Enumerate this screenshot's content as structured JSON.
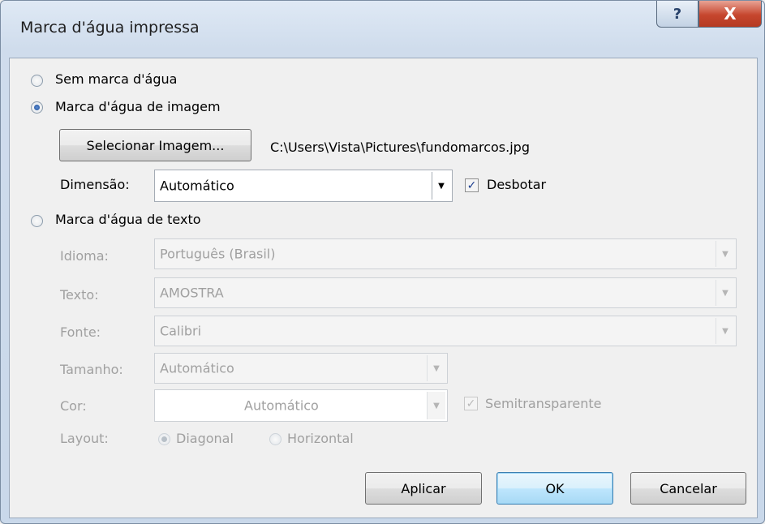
{
  "window": {
    "title": "Marca d'água impressa",
    "help_glyph": "?",
    "close_glyph": "X"
  },
  "options": {
    "no_watermark": "Sem marca d'água",
    "picture_watermark": "Marca d'água de imagem",
    "text_watermark": "Marca d'água de texto"
  },
  "picture": {
    "select_button": "Selecionar Imagem...",
    "path": "C:\\Users\\Vista\\Pictures\\fundomarcos.jpg",
    "scale_label": "Dimensão:",
    "scale_value": "Automático",
    "washout_label": "Desbotar",
    "washout_checked": true
  },
  "text": {
    "language_label": "Idioma:",
    "language_value": "Português (Brasil)",
    "text_label": "Texto:",
    "text_value": "AMOSTRA",
    "font_label": "Fonte:",
    "font_value": "Calibri",
    "size_label": "Tamanho:",
    "size_value": "Automático",
    "color_label": "Cor:",
    "color_value": "Automático",
    "semitransparent_label": "Semitransparente",
    "layout_label": "Layout:",
    "layout_diagonal": "Diagonal",
    "layout_horizontal": "Horizontal"
  },
  "buttons": {
    "apply": "Aplicar",
    "ok": "OK",
    "cancel": "Cancelar"
  }
}
